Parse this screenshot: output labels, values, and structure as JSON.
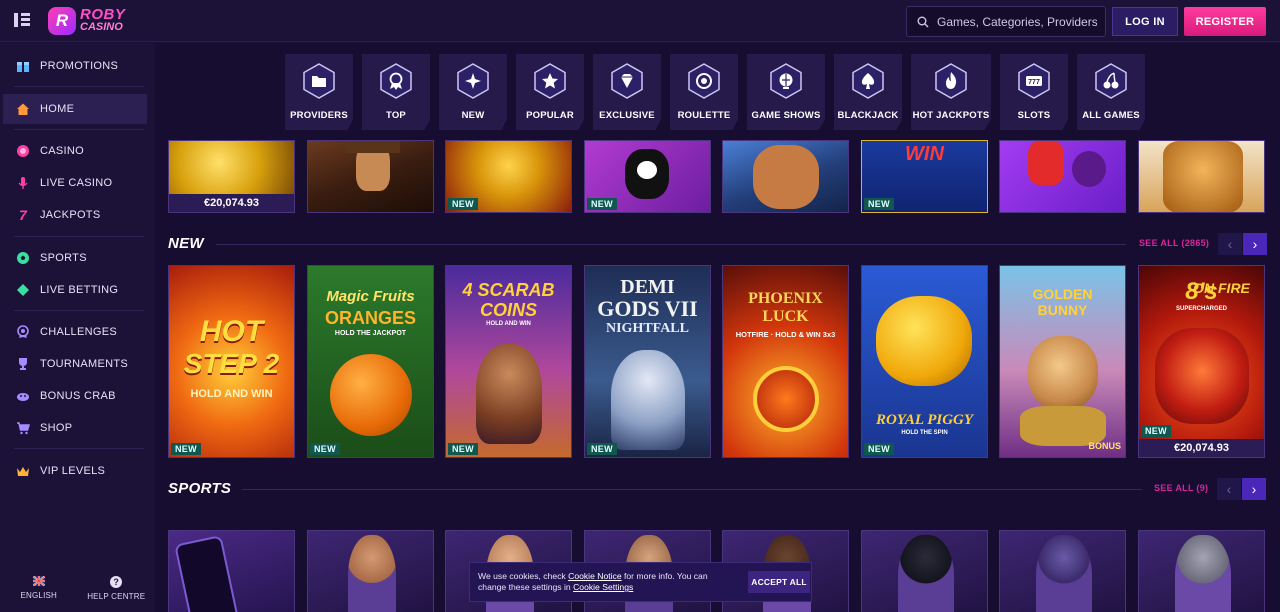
{
  "header": {
    "logo_line1": "ROBY",
    "logo_line2": "CASINO",
    "logo_badge": "R",
    "search_placeholder": "Games, Categories, Providers",
    "login_label": "LOG IN",
    "register_label": "REGISTER"
  },
  "sidebar": {
    "items": [
      {
        "label": "PROMOTIONS",
        "icon": "gift-icon"
      },
      {
        "label": "HOME",
        "icon": "home-icon"
      },
      {
        "label": "CASINO",
        "icon": "casino-chip-icon"
      },
      {
        "label": "LIVE CASINO",
        "icon": "microphone-icon"
      },
      {
        "label": "JACKPOTS",
        "icon": "seven-icon"
      },
      {
        "label": "SPORTS",
        "icon": "soccer-ball-icon"
      },
      {
        "label": "LIVE BETTING",
        "icon": "diamond-icon"
      },
      {
        "label": "CHALLENGES",
        "icon": "medal-icon"
      },
      {
        "label": "TOURNAMENTS",
        "icon": "trophy-icon"
      },
      {
        "label": "BONUS CRAB",
        "icon": "claw-icon"
      },
      {
        "label": "SHOP",
        "icon": "cart-icon"
      },
      {
        "label": "VIP LEVELS",
        "icon": "crown-icon"
      }
    ],
    "active_item": "HOME",
    "footer": {
      "language_label": "ENGLISH",
      "help_label": "HELP CENTRE",
      "help_glyph": "?"
    }
  },
  "categories": [
    {
      "label": "PROVIDERS",
      "icon": "folder-icon"
    },
    {
      "label": "TOP",
      "icon": "award-icon"
    },
    {
      "label": "NEW",
      "icon": "sparkle-icon"
    },
    {
      "label": "POPULAR",
      "icon": "star-icon"
    },
    {
      "label": "EXCLUSIVE",
      "icon": "gem-icon"
    },
    {
      "label": "ROULETTE",
      "icon": "roulette-icon"
    },
    {
      "label": "GAME SHOWS",
      "icon": "showball-icon"
    },
    {
      "label": "BLACKJACK",
      "icon": "spade-icon"
    },
    {
      "label": "HOT JACKPOTS",
      "icon": "flame-icon"
    },
    {
      "label": "SLOTS",
      "icon": "slot-777-icon"
    },
    {
      "label": "ALL GAMES",
      "icon": "cherries-icon"
    }
  ],
  "top_row": {
    "tiles": [
      {
        "badge": "",
        "jackpot": "€20,074.93"
      },
      {
        "badge": "",
        "jackpot": ""
      },
      {
        "badge": "NEW",
        "jackpot": ""
      },
      {
        "badge": "NEW",
        "jackpot": ""
      },
      {
        "badge": "",
        "jackpot": ""
      },
      {
        "badge": "NEW",
        "jackpot": "",
        "art_text": "WIN"
      },
      {
        "badge": "",
        "jackpot": ""
      },
      {
        "badge": "",
        "jackpot": ""
      }
    ]
  },
  "new_section": {
    "title": "NEW",
    "see_all": "SEE ALL (2865)",
    "games": [
      {
        "line1": "HOT",
        "line2": "STEP 2",
        "line3": "HOLD AND WIN",
        "badge": "NEW",
        "jackpot": ""
      },
      {
        "line1": "Magic Fruits",
        "line2": "ORANGES",
        "line3": "HOLD THE JACKPOT",
        "badge": "NEW",
        "jackpot": ""
      },
      {
        "line1": "4 SCARAB",
        "line2": "COINS",
        "line3": "HOLD AND WIN",
        "badge": "NEW",
        "jackpot": ""
      },
      {
        "line1": "DEMI",
        "line2": "GODS VII",
        "line3": "NIGHTFALL",
        "badge": "NEW",
        "jackpot": ""
      },
      {
        "line1": "PHOENIX",
        "line2": "LUCK",
        "line3": "HOTFIRE · HOLD & WIN 3x3",
        "badge": "",
        "jackpot": ""
      },
      {
        "line1": "",
        "line2": "ROYAL PIGGY",
        "line3": "HOLD THE SPIN",
        "badge": "NEW",
        "jackpot": ""
      },
      {
        "line1": "GOLDEN",
        "line2": "BUNNY",
        "line3": "BONUS",
        "badge": "",
        "jackpot": ""
      },
      {
        "line1": "8's",
        "line2": "ON FIRE",
        "line3": "SUPERCHARGED",
        "badge": "NEW",
        "jackpot": "€20,074.93"
      }
    ]
  },
  "sports_section": {
    "title": "SPORTS",
    "see_all": "SEE ALL (9)"
  },
  "cookie": {
    "text_before": "We use cookies, check ",
    "link1": "Cookie Notice",
    "text_mid": " for more info. You can change these settings in ",
    "link2": "Cookie Settings",
    "button": "ACCEPT ALL"
  },
  "colors": {
    "accent_pink": "#d8249d",
    "accent_purple": "#4a27b8",
    "new_badge": "#11564f"
  }
}
